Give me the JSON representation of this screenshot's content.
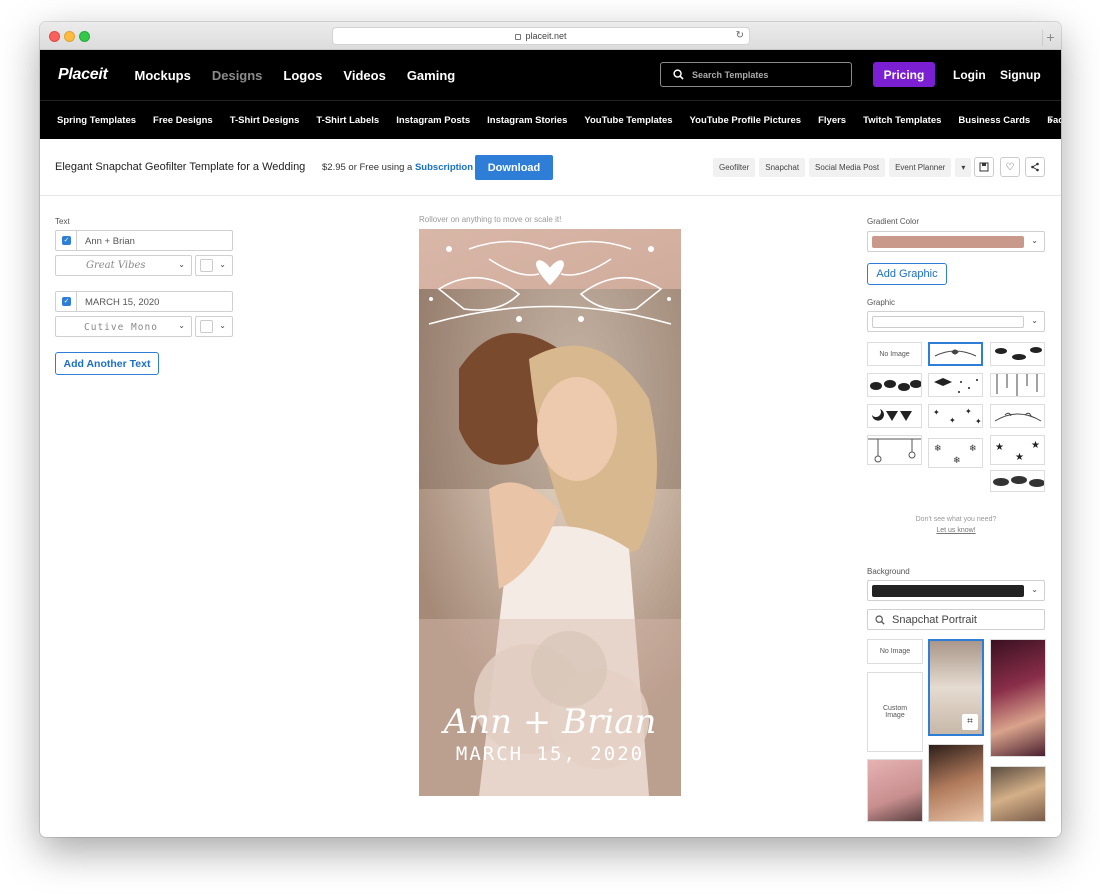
{
  "browser": {
    "url": "placeit.net"
  },
  "nav": {
    "logo": "Placeit",
    "links": [
      "Mockups",
      "Designs",
      "Logos",
      "Videos",
      "Gaming"
    ],
    "search_placeholder": "Search Templates",
    "pricing": "Pricing",
    "login": "Login",
    "signup": "Signup"
  },
  "categories": [
    "Spring Templates",
    "Free Designs",
    "T-Shirt Designs",
    "T-Shirt Labels",
    "Instagram Posts",
    "Instagram Stories",
    "YouTube Templates",
    "YouTube Profile Pictures",
    "Flyers",
    "Twitch Templates",
    "Business Cards",
    "Facebook Posts"
  ],
  "title_bar": {
    "title": "Elegant Snapchat Geofilter Template for a Wedding",
    "price": "$2.95",
    "price_or": "or Free using a",
    "subscription": "Subscription",
    "download": "Download",
    "tags": [
      "Geofilter",
      "Snapchat",
      "Social Media Post",
      "Event Planner"
    ]
  },
  "left_panel": {
    "text_label": "Text",
    "text1_value": "Ann + Brian",
    "font1": "Great Vibes",
    "text2_value": "MARCH 15, 2020",
    "font2": "Cutive Mono",
    "add_text": "Add Another Text"
  },
  "canvas": {
    "hint": "Rollover on anything to move or scale it!",
    "names": "Ann + Brian",
    "date": "MARCH 15, 2020"
  },
  "right_panel": {
    "gradient_label": "Gradient Color",
    "gradient_color": "#c9998c",
    "add_graphic": "Add Graphic",
    "graphic_label": "Graphic",
    "no_image": "No Image",
    "help_line1": "Don't see what you need?",
    "help_link": "Let us know!",
    "background_label": "Background",
    "background_color": "#222222",
    "bg_search_value": "Snapchat Portrait",
    "bg_no_image": "No Image",
    "custom_image": "Custom Image"
  },
  "colors": {
    "accent": "#2e7dd6",
    "pricing": "#7a1fd1",
    "nav_bg": "#000000"
  }
}
